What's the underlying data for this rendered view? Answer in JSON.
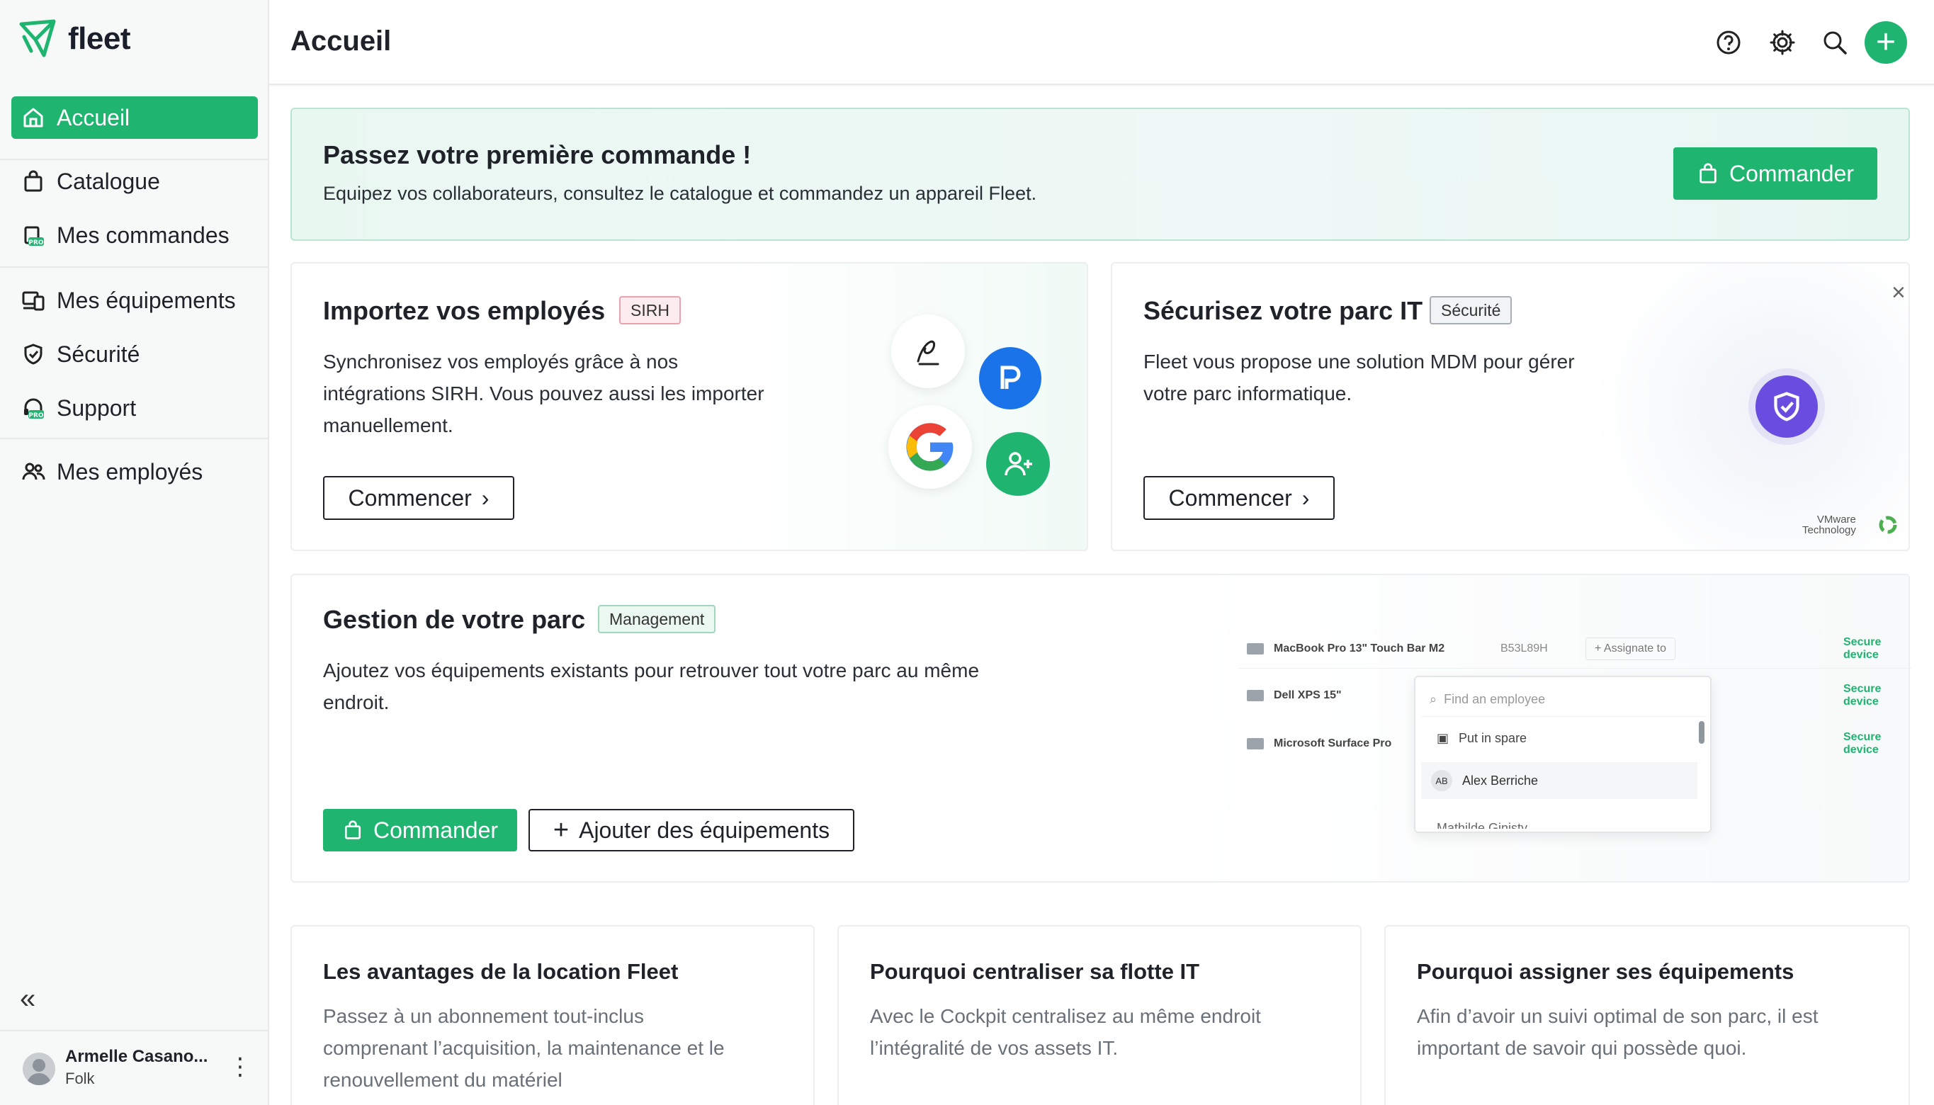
{
  "app": {
    "name": "fleet"
  },
  "colors": {
    "brand": "#1fb46f",
    "violet": "#6a4de0",
    "blue": "#1a73e8"
  },
  "sidebar": {
    "items": [
      {
        "label": "Accueil",
        "icon": "home-icon",
        "active": true
      },
      {
        "label": "Catalogue",
        "icon": "shopping-bag-icon"
      },
      {
        "label": "Mes commandes",
        "icon": "orders-pro-icon"
      },
      {
        "label": "Mes équipements",
        "icon": "devices-icon"
      },
      {
        "label": "Sécurité",
        "icon": "shield-icon"
      },
      {
        "label": "Support",
        "icon": "headset-pro-icon"
      },
      {
        "label": "Mes employés",
        "icon": "users-icon"
      }
    ],
    "user": {
      "name": "Armelle Casano...",
      "company": "Folk"
    }
  },
  "header": {
    "title": "Accueil"
  },
  "banner": {
    "title": "Passez votre première commande !",
    "description": "Equipez vos collaborateurs, consultez le catalogue et commandez un appareil Fleet.",
    "button_label": "Commander"
  },
  "card_import": {
    "title": "Importez vos employés",
    "tag": "SIRH",
    "description_lines": [
      "Synchronisez vos employés grâce à nos",
      "intégrations SIRH. Vous pouvez aussi les importer",
      "manuellement."
    ],
    "button_label": "Commencer"
  },
  "card_security": {
    "title": "Sécurisez votre parc IT",
    "tag": "Sécurité",
    "description_lines": [
      "Fleet vous propose une solution MDM pour gérer",
      "votre parc informatique."
    ],
    "button_label": "Commencer",
    "partner_line1": "VMware",
    "partner_line2": "Technology"
  },
  "card_parc": {
    "title": "Gestion de votre parc",
    "tag": "Management",
    "description_lines": [
      "Ajoutez vos équipements existants pour retrouver tout votre parc au même",
      "endroit."
    ],
    "order_button": "Commander",
    "add_button": "Ajouter des équipements",
    "mock": {
      "devices": [
        {
          "name": "MacBook Pro 13\" Touch Bar M2",
          "serial": "B53L89H",
          "status": "Secure device"
        },
        {
          "name": "Dell XPS 15\"",
          "status": "Secure device"
        },
        {
          "name": "Microsoft Surface Pro",
          "status": "Secure device"
        }
      ],
      "assign_label": "Assignate to",
      "search_placeholder": "Find an employee",
      "options": [
        {
          "label": "Put in spare"
        },
        {
          "initials": "AB",
          "label": "Alex Berriche"
        },
        {
          "label": "Mathilde Ginisty"
        }
      ]
    }
  },
  "articles": [
    {
      "title": "Les avantages de la location Fleet",
      "lines": [
        "Passez à un abonnement tout-inclus",
        "comprenant l’acquisition, la maintenance et le",
        "renouvellement du matériel"
      ]
    },
    {
      "title": "Pourquoi centraliser sa flotte IT",
      "lines": [
        "Avec le Cockpit centralisez au même endroit",
        "l’intégralité de vos assets IT."
      ]
    },
    {
      "title": "Pourquoi assigner ses équipements",
      "lines": [
        "Afin d’avoir un suivi optimal de son parc, il est",
        "important de savoir qui possède quoi."
      ]
    }
  ]
}
